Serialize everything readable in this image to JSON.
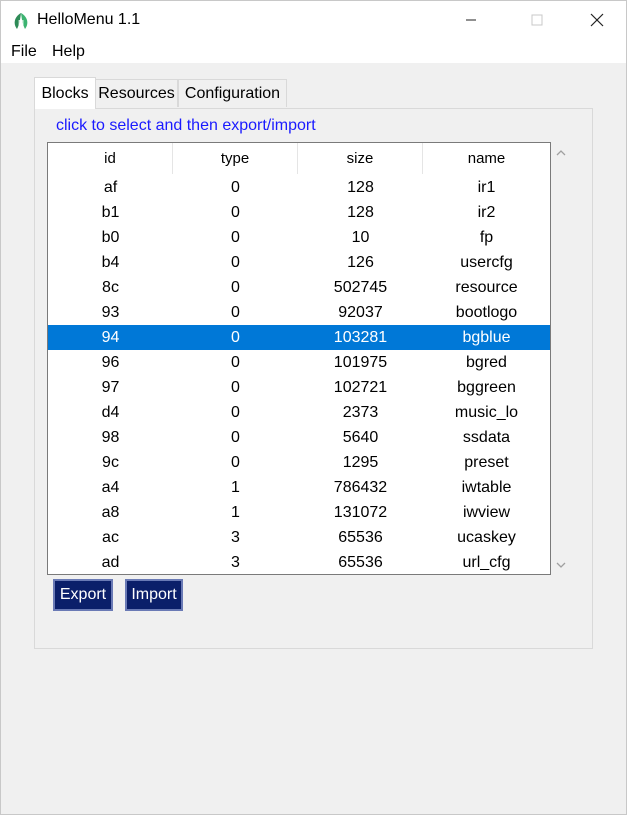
{
  "window": {
    "title": "HelloMenu 1.1",
    "icons": {
      "app": "leaf-logo-icon",
      "minimize": "minimize-icon",
      "maximize": "maximize-icon",
      "close": "close-icon"
    }
  },
  "menu": {
    "file": "File",
    "help": "Help"
  },
  "tabs": {
    "blocks": "Blocks",
    "resources": "Resources",
    "configuration": "Configuration",
    "active": "Blocks"
  },
  "hint": "click to select and then export/import",
  "table": {
    "headers": {
      "id": "id",
      "type": "type",
      "size": "size",
      "name": "name"
    },
    "selected_row": 6,
    "selected_color": "#0078d7",
    "rows": [
      {
        "id": "af",
        "type": "0",
        "size": "128",
        "name": "ir1"
      },
      {
        "id": "b1",
        "type": "0",
        "size": "128",
        "name": "ir2"
      },
      {
        "id": "b0",
        "type": "0",
        "size": "10",
        "name": "fp"
      },
      {
        "id": "b4",
        "type": "0",
        "size": "126",
        "name": "usercfg"
      },
      {
        "id": "8c",
        "type": "0",
        "size": "502745",
        "name": "resource"
      },
      {
        "id": "93",
        "type": "0",
        "size": "92037",
        "name": "bootlogo"
      },
      {
        "id": "94",
        "type": "0",
        "size": "103281",
        "name": "bgblue"
      },
      {
        "id": "96",
        "type": "0",
        "size": "101975",
        "name": "bgred"
      },
      {
        "id": "97",
        "type": "0",
        "size": "102721",
        "name": "bggreen"
      },
      {
        "id": "d4",
        "type": "0",
        "size": "2373",
        "name": "music_lo"
      },
      {
        "id": "98",
        "type": "0",
        "size": "5640",
        "name": "ssdata"
      },
      {
        "id": "9c",
        "type": "0",
        "size": "1295",
        "name": "preset"
      },
      {
        "id": "a4",
        "type": "1",
        "size": "786432",
        "name": "iwtable"
      },
      {
        "id": "a8",
        "type": "1",
        "size": "131072",
        "name": "iwview"
      },
      {
        "id": "ac",
        "type": "3",
        "size": "65536",
        "name": "ucaskey"
      },
      {
        "id": "ad",
        "type": "3",
        "size": "65536",
        "name": "url_cfg"
      }
    ]
  },
  "buttons": {
    "export": "Export",
    "import": "Import",
    "color": "#0b1f6a"
  }
}
